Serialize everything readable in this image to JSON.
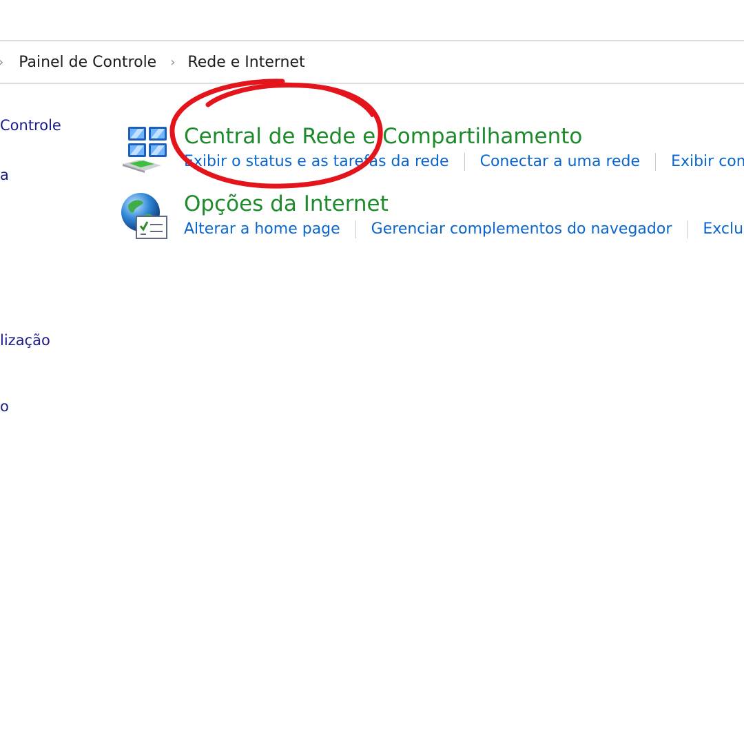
{
  "breadcrumb": {
    "items": [
      "Painel de Controle",
      "Rede e Internet"
    ]
  },
  "sidebar": {
    "items": [
      {
        "label": "Controle"
      },
      {
        "label": "a"
      },
      {
        "label": "lização"
      },
      {
        "label": "o"
      }
    ]
  },
  "categories": [
    {
      "title": "Central de Rede e Compartilhamento",
      "icon": "network-sharing-center-icon",
      "links": [
        "Exibir o status e as tarefas da rede",
        "Conectar a uma rede",
        "Exibir com"
      ]
    },
    {
      "title": "Opções da Internet",
      "icon": "internet-options-globe-icon",
      "links": [
        "Alterar a home page",
        "Gerenciar complementos do navegador",
        "Exclu"
      ]
    }
  ],
  "colors": {
    "category_title": "#1d8a2c",
    "task_link": "#0a66cc",
    "sidebar_link": "#1a1a8c",
    "annotation_circle": "#e3141b"
  }
}
